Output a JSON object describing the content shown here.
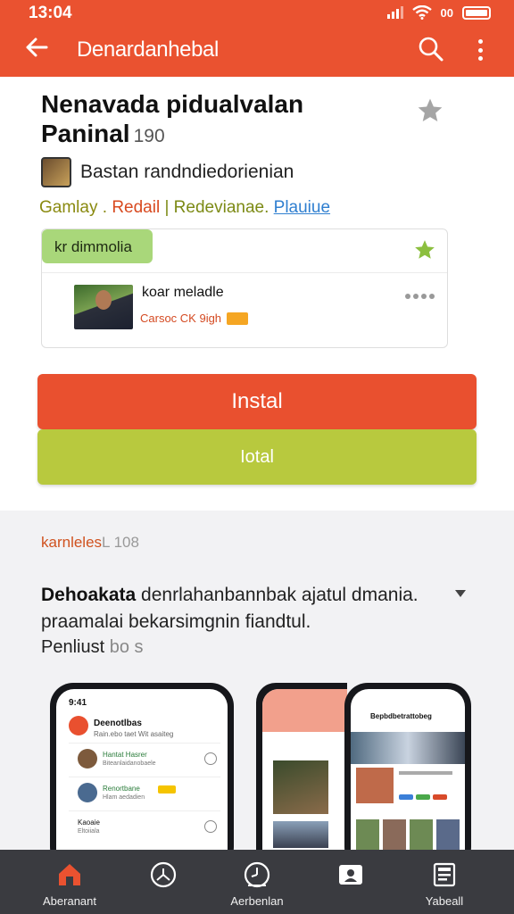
{
  "status_bar": {
    "time": "13:04",
    "battery_label": "00"
  },
  "app_bar": {
    "title": "Denardanhebal",
    "color": "#ea5230"
  },
  "app": {
    "title": "Nenavada pidualvalan Paninal",
    "title_suffix": "190",
    "developer": "Bastan randndiedorienian",
    "tags": [
      "Gamlay .",
      "Redail",
      "| Redevianae.",
      "Plauiue"
    ]
  },
  "review": {
    "chip_label": "kr dimmolia",
    "reviewer_name": "koar meladle",
    "reviewer_meta": "Carsoc CK 9igh"
  },
  "buttons": {
    "install_label": "Instal",
    "secondary_label": "Iotal",
    "install_color": "#e9502f",
    "secondary_color": "#b8c93e"
  },
  "description": {
    "section_label": "karnleles",
    "section_suffix": "L 108",
    "lead": "Dehoakata",
    "body": " denrlahanbannbak ajatul dmania. praamalai bekarsimgnin fiandtul.",
    "read_more": "Penliust",
    "read_more_suffix": "bo s"
  },
  "screenshots": {
    "phone1": {
      "time": "9:41",
      "title": "Deenotlbas",
      "subtitle": "Rain.ebo taet Wit asaiteg",
      "rows": [
        {
          "name": "Hantat Hasrer",
          "detail": "Biteanlaidanobaele"
        },
        {
          "name": "Renortbane",
          "detail": "Hlam aedadien"
        },
        {
          "name": "Kaoaie",
          "detail": "Eltoiiala"
        }
      ]
    },
    "phone3": {
      "title": "Bepbdbetrattobeg"
    }
  },
  "bottom_nav": {
    "items": [
      {
        "label": "Aberanant",
        "icon": "home-icon"
      },
      {
        "label": "",
        "icon": "clock-icon"
      },
      {
        "label": "Aerbenlan",
        "icon": "timer-icon"
      },
      {
        "label": "",
        "icon": "profile-card-icon"
      },
      {
        "label": "Yabeall",
        "icon": "library-icon"
      }
    ]
  }
}
